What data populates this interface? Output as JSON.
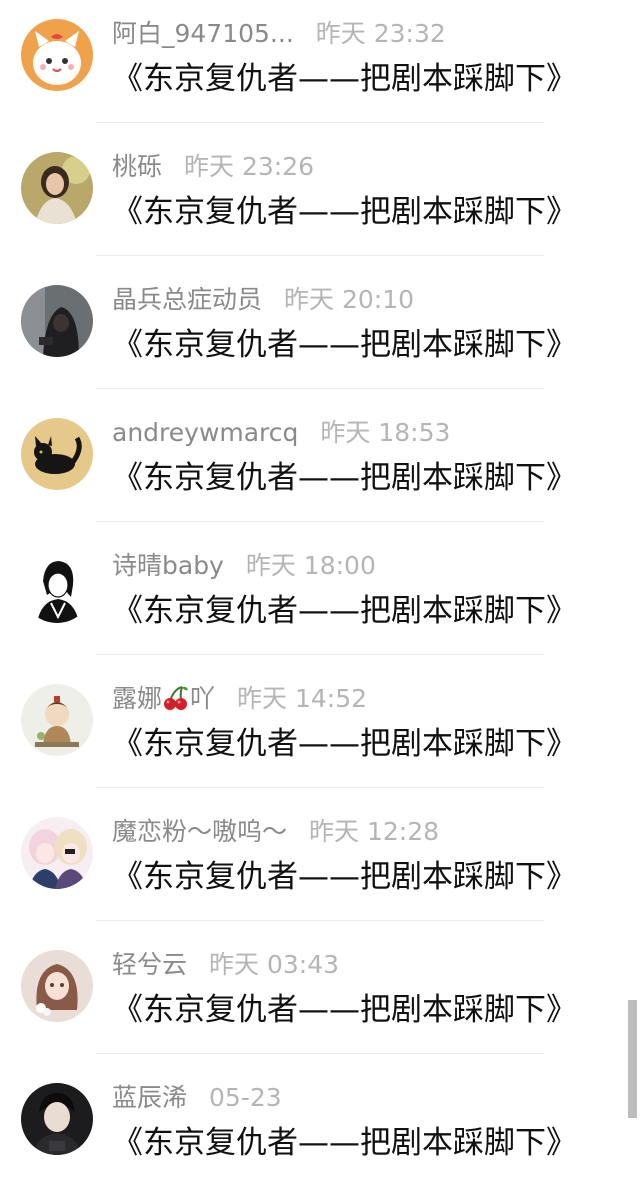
{
  "comments": [
    {
      "name": "阿白_947105...",
      "time": "昨天 23:32",
      "text": "《东京复仇者——把剧本踩脚下》",
      "avatar": "cartoon-cat-avatar"
    },
    {
      "name": "桃砾",
      "time": "昨天 23:26",
      "text": "《东京复仇者——把剧本踩脚下》",
      "avatar": "girl-photo-avatar"
    },
    {
      "name": "晶兵总症动员",
      "time": "昨天 20:10",
      "text": "《东京复仇者——把剧本踩脚下》",
      "avatar": "hooded-figure-avatar"
    },
    {
      "name": "andreywmarcq",
      "time": "昨天 18:53",
      "text": "《东京复仇者——把剧本踩脚下》",
      "avatar": "black-cat-avatar"
    },
    {
      "name": "诗晴baby",
      "time": "昨天 18:00",
      "text": "《东京复仇者——把剧本踩脚下》",
      "avatar": "anime-sketch-avatar"
    },
    {
      "name": "露娜",
      "name_suffix": "吖",
      "time": "昨天 14:52",
      "text": "《东京复仇者——把剧本踩脚下》",
      "avatar": "chibi-character-avatar",
      "emoji": "cherries"
    },
    {
      "name": "魔恋粉～嗷呜～",
      "time": "昨天 12:28",
      "text": "《东京复仇者——把剧本踩脚下》",
      "avatar": "anime-pair-avatar"
    },
    {
      "name": "轻兮云",
      "time": "昨天 03:43",
      "text": "《东京复仇者——把剧本踩脚下》",
      "avatar": "anime-girl-avatar"
    },
    {
      "name": "蓝辰浠",
      "time": "05-23",
      "text": "《东京复仇者——把剧本踩脚下》",
      "avatar": "boy-photo-avatar"
    }
  ],
  "colors": {
    "name": "#8a8a8a",
    "time": "#b5b5b5",
    "message": "#111111",
    "divider": "#ececec"
  }
}
